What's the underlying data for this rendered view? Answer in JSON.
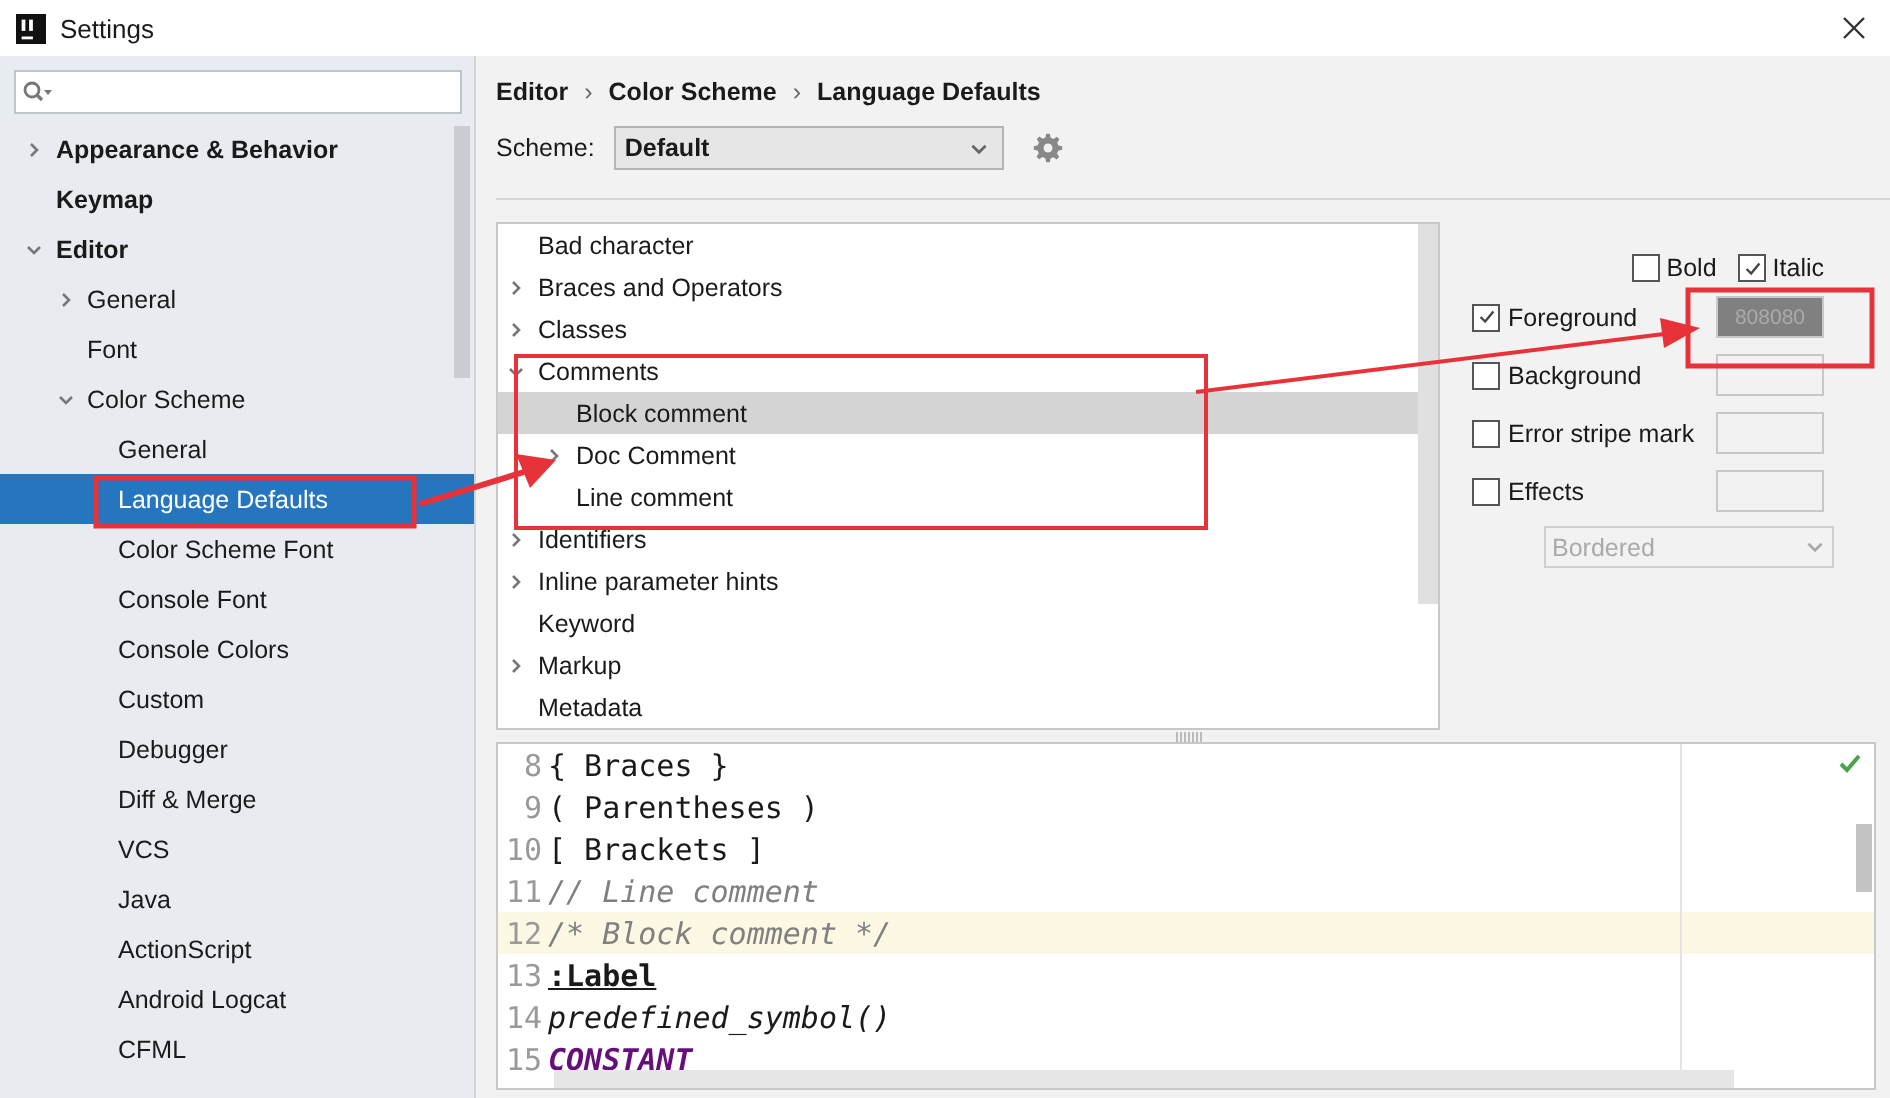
{
  "window": {
    "title": "Settings"
  },
  "sidebar": {
    "items": [
      {
        "label": "Appearance & Behavior",
        "expanded": false,
        "selected": false
      },
      {
        "label": "Keymap",
        "selected": false
      },
      {
        "label": "Editor",
        "expanded": true,
        "selected": false,
        "children": [
          {
            "label": "General",
            "expanded": false,
            "selected": false
          },
          {
            "label": "Font",
            "selected": false
          },
          {
            "label": "Color Scheme",
            "expanded": true,
            "selected": false,
            "children": [
              {
                "label": "General",
                "selected": false
              },
              {
                "label": "Language Defaults",
                "selected": true
              },
              {
                "label": "Color Scheme Font",
                "selected": false
              },
              {
                "label": "Console Font",
                "selected": false
              },
              {
                "label": "Console Colors",
                "selected": false
              },
              {
                "label": "Custom",
                "selected": false
              },
              {
                "label": "Debugger",
                "selected": false
              },
              {
                "label": "Diff & Merge",
                "selected": false
              },
              {
                "label": "VCS",
                "selected": false
              },
              {
                "label": "Java",
                "selected": false
              },
              {
                "label": "ActionScript",
                "selected": false
              },
              {
                "label": "Android Logcat",
                "selected": false
              },
              {
                "label": "CFML",
                "selected": false
              }
            ]
          }
        ]
      }
    ]
  },
  "breadcrumb": [
    "Editor",
    "Color Scheme",
    "Language Defaults"
  ],
  "breadcrumb_separator": "›",
  "scheme": {
    "label": "Scheme:",
    "value": "Default"
  },
  "attributes": [
    {
      "label": "Bad character",
      "selected": false
    },
    {
      "label": "Braces and Operators",
      "expanded": false,
      "selected": false
    },
    {
      "label": "Classes",
      "expanded": false,
      "selected": false
    },
    {
      "label": "Comments",
      "expanded": true,
      "selected": false,
      "children": [
        {
          "label": "Block comment",
          "selected": true
        },
        {
          "label": "Doc Comment",
          "expanded": false,
          "selected": false
        },
        {
          "label": "Line comment",
          "selected": false
        }
      ]
    },
    {
      "label": "Identifiers",
      "expanded": false,
      "selected": false
    },
    {
      "label": "Inline parameter hints",
      "expanded": false,
      "selected": false
    },
    {
      "label": "Keyword",
      "selected": false
    },
    {
      "label": "Markup",
      "expanded": false,
      "selected": false
    },
    {
      "label": "Metadata",
      "selected": false
    }
  ],
  "style": {
    "bold": {
      "label": "Bold",
      "checked": false
    },
    "italic": {
      "label": "Italic",
      "checked": true
    }
  },
  "colors": [
    {
      "label": "Foreground",
      "checked": true,
      "value": "808080",
      "color": "#808080"
    },
    {
      "label": "Background",
      "checked": false
    },
    {
      "label": "Error stripe mark",
      "checked": false
    },
    {
      "label": "Effects",
      "checked": false
    }
  ],
  "effect_type": {
    "value": "Bordered",
    "disabled": true
  },
  "preview": {
    "lines": [
      {
        "number": "8",
        "text": "{ Braces }",
        "kind": "plain",
        "current": false
      },
      {
        "number": "9",
        "text": "( Parentheses )",
        "kind": "plain",
        "current": false
      },
      {
        "number": "10",
        "text": "[ Brackets ]",
        "kind": "plain",
        "current": false
      },
      {
        "number": "11",
        "text": "// Line comment",
        "kind": "comment",
        "current": false
      },
      {
        "number": "12",
        "text": "/* Block comment */",
        "kind": "comment",
        "current": true
      },
      {
        "number": "13",
        "text": ":Label",
        "kind": "label",
        "current": false
      },
      {
        "number": "14",
        "text": "predefined_symbol()",
        "kind": "predefined",
        "current": false
      },
      {
        "number": "15",
        "text": "CONSTANT",
        "kind": "constant",
        "current": false
      }
    ]
  }
}
